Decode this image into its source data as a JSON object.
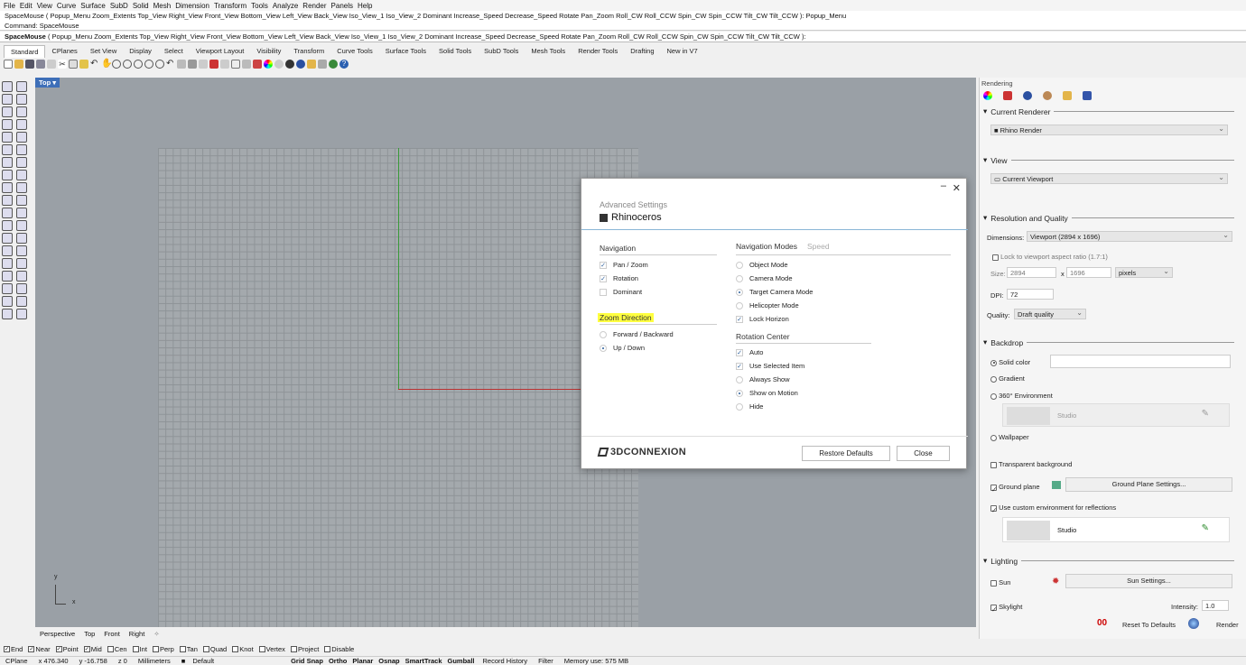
{
  "menubar": [
    "File",
    "Edit",
    "View",
    "Curve",
    "Surface",
    "SubD",
    "Solid",
    "Mesh",
    "Dimension",
    "Transform",
    "Tools",
    "Analyze",
    "Render",
    "Panels",
    "Help"
  ],
  "command_history": [
    "SpaceMouse ( Popup_Menu  Zoom_Extents  Top_View  Right_View  Front_View  Bottom_View  Left_View  Back_View  Iso_View_1  Iso_View_2  Dominant  Increase_Speed  Decrease_Speed  Rotate  Pan_Zoom  Roll_CW  Roll_CCW  Spin_CW  Spin_CCW  Tilt_CW  Tilt_CCW ): Popup_Menu",
    "Command: SpaceMouse"
  ],
  "command_line": {
    "prefix": "SpaceMouse",
    "options": "( Popup_Menu  Zoom_Extents  Top_View  Right_View  Front_View  Bottom_View  Left_View  Back_View  Iso_View_1  Iso_View_2  Dominant  Increase_Speed  Decrease_Speed  Rotate  Pan_Zoom  Roll_CW  Roll_CCW  Spin_CW  Spin_CCW  Tilt_CW  Tilt_CCW ):"
  },
  "toolbar_tabs": [
    "Standard",
    "CPlanes",
    "Set View",
    "Display",
    "Select",
    "Viewport Layout",
    "Visibility",
    "Transform",
    "Curve Tools",
    "Surface Tools",
    "Solid Tools",
    "SubD Tools",
    "Mesh Tools",
    "Render Tools",
    "Drafting",
    "New in V7"
  ],
  "viewport": {
    "title": "Top",
    "axis_x": "x",
    "axis_y": "y"
  },
  "viewport_tabs": [
    "Perspective",
    "Top",
    "Front",
    "Right"
  ],
  "osnaps": [
    {
      "label": "End",
      "checked": true
    },
    {
      "label": "Near",
      "checked": true
    },
    {
      "label": "Point",
      "checked": true
    },
    {
      "label": "Mid",
      "checked": true
    },
    {
      "label": "Cen",
      "checked": false
    },
    {
      "label": "Int",
      "checked": false
    },
    {
      "label": "Perp",
      "checked": false
    },
    {
      "label": "Tan",
      "checked": false
    },
    {
      "label": "Quad",
      "checked": false
    },
    {
      "label": "Knot",
      "checked": false
    },
    {
      "label": "Vertex",
      "checked": false
    },
    {
      "label": "Project",
      "checked": false
    },
    {
      "label": "Disable",
      "checked": false
    }
  ],
  "statusbar": {
    "cplane": "CPlane",
    "x": "x 476.340",
    "y": "y -16.758",
    "z": "z 0",
    "units": "Millimeters",
    "layer": "Default",
    "toggles": [
      "Grid Snap",
      "Ortho",
      "Planar",
      "Osnap",
      "SmartTrack",
      "Gumball"
    ],
    "record": "Record History",
    "filter": "Filter",
    "memory": "Memory use: 575 MB"
  },
  "panel": {
    "title": "Rendering",
    "current_renderer": {
      "header": "Current Renderer",
      "value": "Rhino Render"
    },
    "view": {
      "header": "View",
      "value": "Current Viewport"
    },
    "resolution": {
      "header": "Resolution and Quality",
      "dimensions_label": "Dimensions:",
      "dimensions_value": "Viewport (2894 x 1696)",
      "lock_label": "Lock to viewport aspect ratio (1.7:1)",
      "size_label": "Size:",
      "width": "2894",
      "x_sep": "x",
      "height": "1696",
      "unit": "pixels",
      "dpi_label": "DPI:",
      "dpi": "72",
      "quality_label": "Quality:",
      "quality": "Draft quality"
    },
    "backdrop": {
      "header": "Backdrop",
      "solid": "Solid color",
      "gradient": "Gradient",
      "env": "360° Environment",
      "env_value": "Studio",
      "wallpaper": "Wallpaper",
      "transparent": "Transparent background",
      "ground": "Ground plane",
      "ground_btn": "Ground Plane Settings...",
      "custom_env": "Use custom environment for reflections",
      "custom_env_value": "Studio"
    },
    "lighting": {
      "header": "Lighting",
      "sun": "Sun",
      "sun_btn": "Sun Settings...",
      "skylight": "Skylight",
      "intensity_label": "Intensity:",
      "intensity": "1.0"
    },
    "reset": "Reset To Defaults",
    "render": "Render"
  },
  "dialog": {
    "subtitle": "Advanced Settings",
    "title": "Rhinoceros",
    "navigation": {
      "header": "Navigation",
      "items": [
        {
          "label": "Pan / Zoom",
          "checked": true
        },
        {
          "label": "Rotation",
          "checked": true
        },
        {
          "label": "Dominant",
          "checked": false
        }
      ]
    },
    "zoom_direction": {
      "header": "Zoom Direction",
      "items": [
        {
          "label": "Forward / Backward",
          "selected": false
        },
        {
          "label": "Up / Down",
          "selected": true
        }
      ]
    },
    "nav_modes": {
      "tab_active": "Navigation Modes",
      "tab_inactive": "Speed",
      "items": [
        {
          "label": "Object Mode",
          "selected": false
        },
        {
          "label": "Camera Mode",
          "selected": false
        },
        {
          "label": "Target Camera Mode",
          "selected": true
        },
        {
          "label": "Helicopter Mode",
          "selected": false
        }
      ],
      "lock": {
        "label": "Lock Horizon",
        "checked": true
      }
    },
    "rotation_center": {
      "header": "Rotation Center",
      "auto": {
        "label": "Auto",
        "checked": true
      },
      "use_selected": {
        "label": "Use Selected Item",
        "checked": true
      },
      "items": [
        {
          "label": "Always Show",
          "selected": false
        },
        {
          "label": "Show on Motion",
          "selected": true
        },
        {
          "label": "Hide",
          "selected": false
        }
      ]
    },
    "logo": "3DCONNEXION",
    "restore": "Restore Defaults",
    "close": "Close"
  }
}
